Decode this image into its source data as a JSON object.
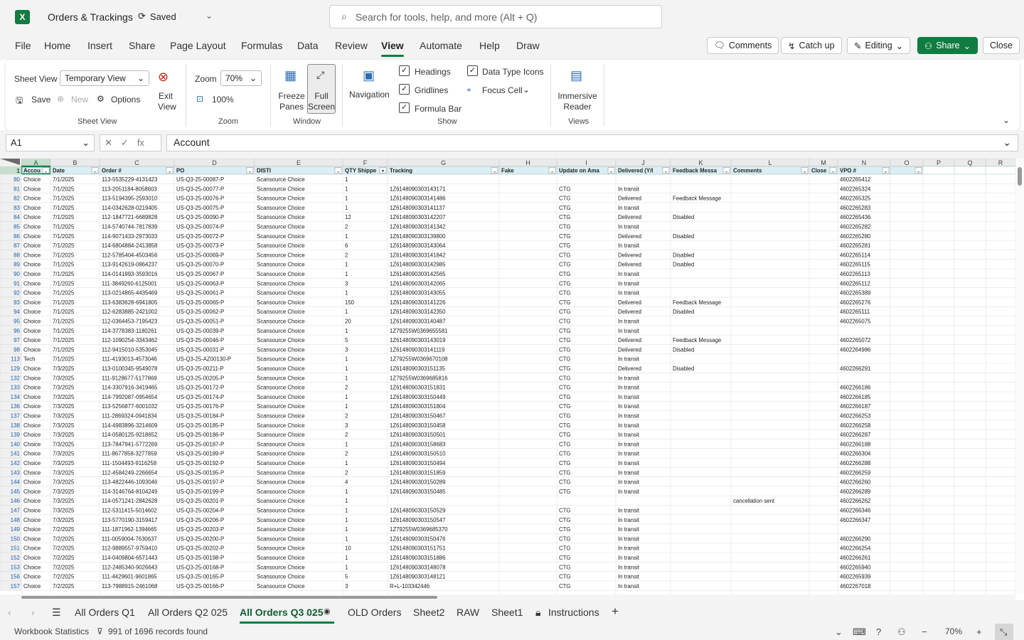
{
  "app": {
    "title": "Orders & Trackings",
    "saved": "Saved",
    "logo": "X",
    "search_placeholder": "Search for tools, help, and more (Alt + Q)"
  },
  "menu": [
    "File",
    "Home",
    "Insert",
    "Share",
    "Page Layout",
    "Formulas",
    "Data",
    "Review",
    "View",
    "Automate",
    "Help",
    "Draw"
  ],
  "menu_active": "View",
  "top_buttons": {
    "comments": "Comments",
    "catch_up": "Catch up",
    "editing": "Editing",
    "share": "Share",
    "close": "Close"
  },
  "ribbon": {
    "sheet_view": "Sheet View",
    "temporary_view": "Temporary View",
    "exit_view": "Exit View",
    "save": "Save",
    "new": "New",
    "options": "Options",
    "sheet_view_group": "Sheet View",
    "zoom_label": "Zoom",
    "zoom_value": "70%",
    "zoom_100": "100%",
    "zoom_group": "Zoom",
    "freeze_panes": "Freeze Panes",
    "full_screen": "Full Screen",
    "window_group": "Window",
    "navigation": "Navigation",
    "headings": "Headings",
    "gridlines": "Gridlines",
    "formula_bar": "Formula Bar",
    "data_type_icons": "Data Type Icons",
    "focus_cell": "Focus Cell",
    "show_group": "Show",
    "immersive_reader": "Immersive Reader",
    "views_group": "Views"
  },
  "formula_bar": {
    "cell_ref": "A1",
    "content": "Account"
  },
  "columns": [
    "A",
    "B",
    "C",
    "D",
    "E",
    "F",
    "G",
    "H",
    "I",
    "J",
    "K",
    "L",
    "M",
    "N",
    "O",
    "P",
    "Q",
    "R"
  ],
  "headers": [
    "Accou",
    "Date",
    "Order #",
    "PO",
    "DISTI",
    "QTY Shippe",
    "Tracking",
    "Fake",
    "Update on Ama",
    "Delivered (Y/I",
    "Feedback Messa",
    "Comments",
    "Close",
    "VPO #",
    "",
    "",
    "",
    ""
  ],
  "rows": [
    [
      "80",
      "Choice",
      "7/1/2025",
      "113-5535229-4131423",
      "US-Q3-25-00087-P",
      "Scansource Choice",
      "1",
      "",
      "",
      "",
      "",
      "",
      "",
      "",
      "4602265412"
    ],
    [
      "81",
      "Choice",
      "7/1/2025",
      "113-2051184-8058603",
      "US-Q3-25-00077-P",
      "Scansource Choice",
      "1",
      "1Z6148090303143171",
      "",
      "CTG",
      "In transit",
      "",
      "",
      "",
      "4602265324"
    ],
    [
      "82",
      "Choice",
      "7/1/2025",
      "113-5194395-2593010",
      "US-Q3-25-00076-P",
      "Scansource Choice",
      "1",
      "1Z6148090303141486",
      "",
      "CTG",
      "Delivered",
      "Feedback Message",
      "",
      "",
      "4602265325"
    ],
    [
      "83",
      "Choice",
      "7/1/2025",
      "114-0342628-0219405",
      "US-Q3-25-00075-P",
      "Scansource Choice",
      "1",
      "1Z6148090303141137",
      "",
      "CTG",
      "In transit",
      "",
      "",
      "",
      "4602265283"
    ],
    [
      "84",
      "Choice",
      "7/1/2025",
      "112-1847721-6689828",
      "US-Q3-25-00090-P",
      "Scansource Choice",
      "12",
      "1Z6148090303142207",
      "",
      "CTG",
      "Delivered",
      "Disabled",
      "",
      "",
      "4602265436"
    ],
    [
      "85",
      "Choice",
      "7/1/2025",
      "114-5740744-7817839",
      "US-Q3-25-00074-P",
      "Scansource Choice",
      "2",
      "1Z6148090303141342",
      "",
      "CTG",
      "In transit",
      "",
      "",
      "",
      "4602265282"
    ],
    [
      "86",
      "Choice",
      "7/1/2025",
      "114-9071433-2973033",
      "US-Q3-25-00072-P",
      "Scansource Choice",
      "1",
      "1Z6148090303139800",
      "",
      "CTG",
      "Delivered",
      "Disabled",
      "",
      "",
      "4602265280"
    ],
    [
      "87",
      "Choice",
      "7/1/2025",
      "114-6804884-2413858",
      "US-Q3-25-00073-P",
      "Scansource Choice",
      "6",
      "1Z6148090303143064",
      "",
      "CTG",
      "In transit",
      "",
      "",
      "",
      "4602265281"
    ],
    [
      "88",
      "Choice",
      "7/1/2025",
      "112-5785404-4503456",
      "US-Q3-25-00069-P",
      "Scansource Choice",
      "2",
      "1Z6148090303141842",
      "",
      "CTG",
      "Delivered",
      "Disabled",
      "",
      "",
      "4602265114"
    ],
    [
      "89",
      "Choice",
      "7/1/2025",
      "113-9142619-0864237",
      "US-Q3-25-00070-P",
      "Scansource Choice",
      "1",
      "1Z6148090303142985",
      "",
      "CTG",
      "Delivered",
      "Disabled",
      "",
      "",
      "4602265115"
    ],
    [
      "90",
      "Choice",
      "7/1/2025",
      "114-0141993-3593016",
      "US-Q3-25-00067-P",
      "Scansource Choice",
      "1",
      "1Z6148090303142565",
      "",
      "CTG",
      "In transit",
      "",
      "",
      "",
      "4602265113"
    ],
    [
      "91",
      "Choice",
      "7/1/2025",
      "111-3849260-6125001",
      "US-Q3-25-00063-P",
      "Scansource Choice",
      "3",
      "1Z6148090303142065",
      "",
      "CTG",
      "In transit",
      "",
      "",
      "",
      "4602265112"
    ],
    [
      "92",
      "Choice",
      "7/1/2025",
      "113-0214865-4435469",
      "US-Q3-25-00061-P",
      "Scansource Choice",
      "1",
      "1Z6148090303143055",
      "",
      "CTG",
      "In transit",
      "",
      "",
      "",
      "4602265389"
    ],
    [
      "93",
      "Choice",
      "7/1/2025",
      "113-6383628-6941805",
      "US-Q3-25-00065-P",
      "Scansource Choice",
      "150",
      "1Z6148090303141226",
      "",
      "CTG",
      "Delivered",
      "Feedback Message",
      "",
      "",
      "4602265276"
    ],
    [
      "94",
      "Choice",
      "7/1/2025",
      "112-6283885-2421002",
      "US-Q3-25-00062-P",
      "Scansource Choice",
      "1",
      "1Z6148090303142350",
      "",
      "CTG",
      "Delivered",
      "Disabled",
      "",
      "",
      "4602265111"
    ],
    [
      "95",
      "Choice",
      "7/1/2025",
      "112-0364453-7195423",
      "US-Q3-25-00051-P",
      "Scansource Choice",
      "20",
      "1Z6148090303140487",
      "",
      "CTG",
      "In transit",
      "",
      "",
      "",
      "4602265075"
    ],
    [
      "96",
      "Choice",
      "7/1/2025",
      "114-3778383-1180261",
      "US-Q3-25-00039-P",
      "Scansource Choice",
      "1",
      "1Z79255W0369655581",
      "",
      "CTG",
      "In transit",
      "",
      "",
      "",
      ""
    ],
    [
      "97",
      "Choice",
      "7/1/2025",
      "112-1090254-3343462",
      "US-Q3-25-00046-P",
      "Scansource Choice",
      "5",
      "1Z6148090303143019",
      "",
      "CTG",
      "Delivered",
      "Feedback Message",
      "",
      "",
      "4602265072"
    ],
    [
      "98",
      "Choice",
      "7/1/2025",
      "112-9415010-5353045",
      "US-Q3-25-00031-P",
      "Scansource Choice",
      "3",
      "1Z6148090303141119",
      "",
      "CTG",
      "Delivered",
      "Disabled",
      "",
      "",
      "4602264986"
    ],
    [
      "113",
      "Tech",
      "7/1/2025",
      "111-4193013-4573046",
      "US-Q3-25-AZ00130-P",
      "Scansource Choice",
      "1",
      "1Z79255W0369670108",
      "",
      "CTG",
      "In transit",
      "",
      "",
      "",
      ""
    ],
    [
      "129",
      "Choice",
      "7/3/2025",
      "113-0100345-9549078",
      "US-Q3-25-00211-P",
      "Scansource Choice",
      "1",
      "1Z6148090303151135",
      "",
      "CTG",
      "Delivered",
      "Disabled",
      "",
      "",
      "4602266291"
    ],
    [
      "132",
      "Choice",
      "7/3/2025",
      "111-9128677-5177869",
      "US-Q3-25-00205-P",
      "Scansource Choice",
      "1",
      "1Z79255W0369685816",
      "",
      "CTG",
      "In transit",
      "",
      "",
      "",
      ""
    ],
    [
      "133",
      "Choice",
      "7/3/2025",
      "114-3307916-3419465",
      "US-Q3-25-00172-P",
      "Scansource Choice",
      "2",
      "1Z6148090303151831",
      "",
      "CTG",
      "In transit",
      "",
      "",
      "",
      "4602266186"
    ],
    [
      "134",
      "Choice",
      "7/3/2025",
      "114-7992087-0954654",
      "US-Q3-25-00174-P",
      "Scansource Choice",
      "1",
      "1Z6148090303150449",
      "",
      "CTG",
      "In transit",
      "",
      "",
      "",
      "4602266185"
    ],
    [
      "136",
      "Choice",
      "7/3/2025",
      "113-5256877-6001032",
      "US-Q3-25-00176-P",
      "Scansource Choice",
      "1",
      "1Z6148090303151804",
      "",
      "CTG",
      "In transit",
      "",
      "",
      "",
      "4602266187"
    ],
    [
      "137",
      "Choice",
      "7/3/2025",
      "111-2869324-0941834",
      "US-Q3-25-00184-P",
      "Scansource Choice",
      "2",
      "1Z6148090303150467",
      "",
      "CTG",
      "In transit",
      "",
      "",
      "",
      "4602266253"
    ],
    [
      "138",
      "Choice",
      "7/3/2025",
      "114-4983896-3214609",
      "US-Q3-25-00185-P",
      "Scansource Choice",
      "3",
      "1Z6148090303150458",
      "",
      "CTG",
      "In transit",
      "",
      "",
      "",
      "4602266258"
    ],
    [
      "139",
      "Choice",
      "7/3/2025",
      "114-0580125-9218652",
      "US-Q3-25-00186-P",
      "Scansource Choice",
      "2",
      "1Z6148090303150501",
      "",
      "CTG",
      "In transit",
      "",
      "",
      "",
      "4602266287"
    ],
    [
      "140",
      "Choice",
      "7/3/2025",
      "113-7847941-5772269",
      "US-Q3-25-00187-P",
      "Scansource Choice",
      "1",
      "1Z6148090303158683",
      "",
      "CTG",
      "In transit",
      "",
      "",
      "",
      "4602266188"
    ],
    [
      "141",
      "Choice",
      "7/3/2025",
      "111-8677858-3277859",
      "US-Q3-25-00189-P",
      "Scansource Choice",
      "2",
      "1Z6148090303150510",
      "",
      "CTG",
      "In transit",
      "",
      "",
      "",
      "4602266304"
    ],
    [
      "142",
      "Choice",
      "7/3/2025",
      "111-1504493-9116258",
      "US-Q3-25-00192-P",
      "Scansource Choice",
      "1",
      "1Z6148090303150494",
      "",
      "CTG",
      "In transit",
      "",
      "",
      "",
      "4602266288"
    ],
    [
      "143",
      "Choice",
      "7/3/2025",
      "112-4584249-2266654",
      "US-Q3-25-00195-P",
      "Scansource Choice",
      "2",
      "1Z6148090303151859",
      "",
      "CTG",
      "In transit",
      "",
      "",
      "",
      "4602266259"
    ],
    [
      "144",
      "Choice",
      "7/3/2025",
      "113-4822446-1093046",
      "US-Q3-25-00197-P",
      "Scansource Choice",
      "4",
      "1Z6148090303150289",
      "",
      "CTG",
      "In transit",
      "",
      "",
      "",
      "4602266260"
    ],
    [
      "145",
      "Choice",
      "7/3/2025",
      "114-3146764-8104249",
      "US-Q3-25-00199-P",
      "Scansource Choice",
      "1",
      "1Z6148090303150485",
      "",
      "CTG",
      "In transit",
      "",
      "",
      "",
      "4602266289"
    ],
    [
      "146",
      "Choice",
      "7/3/2025",
      "114-0571241-2842628",
      "US-Q3-25-00201-P",
      "Scansource Choice",
      "1",
      "",
      "",
      "",
      "",
      "",
      "cancellation sent",
      "",
      "4602266262"
    ],
    [
      "147",
      "Choice",
      "7/3/2025",
      "112-5311415-5014602",
      "US-Q3-25-00204-P",
      "Scansource Choice",
      "1",
      "1Z6148090303150529",
      "",
      "CTG",
      "In transit",
      "",
      "",
      "",
      "4602266346"
    ],
    [
      "148",
      "Choice",
      "7/3/2025",
      "113-5770190-3159417",
      "US-Q3-25-00206-P",
      "Scansource Choice",
      "1",
      "1Z6148090303150547",
      "",
      "CTG",
      "In transit",
      "",
      "",
      "",
      "4602266347"
    ],
    [
      "149",
      "Choice",
      "7/2/2025",
      "111-1871962-1394665",
      "US-Q3-25-00203-P",
      "Scansource Choice",
      "1",
      "1Z79255W0369685370",
      "",
      "CTG",
      "In transit",
      "",
      "",
      "",
      ""
    ],
    [
      "150",
      "Choice",
      "7/2/2025",
      "111-0059004-7630637",
      "US-Q3-25-00200-P",
      "Scansource Choice",
      "1",
      "1Z6148090303150476",
      "",
      "CTG",
      "In transit",
      "",
      "",
      "",
      "4602266290"
    ],
    [
      "151",
      "Choice",
      "7/2/2025",
      "112-9889557-9759410",
      "US-Q3-25-00202-P",
      "Scansource Choice",
      "10",
      "1Z6148090303151751",
      "",
      "CTG",
      "In transit",
      "",
      "",
      "",
      "4602266254"
    ],
    [
      "152",
      "Choice",
      "7/2/2025",
      "114-0409804-6571443",
      "US-Q3-25-00198-P",
      "Scansource Choice",
      "1",
      "1Z6148090303151886",
      "",
      "CTG",
      "In transit",
      "",
      "",
      "",
      "4602266261"
    ],
    [
      "153",
      "Choice",
      "7/2/2025",
      "112-2485340-9026643",
      "US-Q3-25-00168-P",
      "Scansource Choice",
      "1",
      "1Z6148090303148078",
      "",
      "CTG",
      "In transit",
      "",
      "",
      "",
      "4602265940"
    ],
    [
      "156",
      "Choice",
      "7/2/2025",
      "111-4429601-9601865",
      "US-Q3-25-00165-P",
      "Scansource Choice",
      "5",
      "1Z6148090303148121",
      "",
      "CTG",
      "In transit",
      "",
      "",
      "",
      "4602265939"
    ],
    [
      "157",
      "Choice",
      "7/2/2025",
      "113-7988915-2461068",
      "US-Q3-25-00166-P",
      "Scansource Choice",
      "3",
      "R+L-103342446",
      "",
      "CTG",
      "In transit",
      "",
      "",
      "",
      "4602267018"
    ]
  ],
  "sheet_tabs": [
    "All Orders Q1",
    "All Orders Q2 025",
    "All Orders Q3 025",
    "OLD Orders",
    "Sheet2",
    "RAW",
    "Sheet1",
    "Instructions"
  ],
  "active_sheet": "All Orders Q3 025",
  "status": {
    "workbook_statistics": "Workbook Statistics",
    "filter_text": "991 of 1696 records found",
    "zoom": "70%"
  },
  "colors": {
    "accent": "#107c41",
    "header_fill": "#daeef3"
  }
}
